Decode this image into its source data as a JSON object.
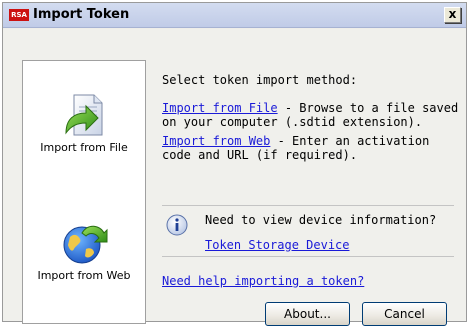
{
  "window": {
    "title": "Import Token",
    "logo_text": "RSA",
    "close_label": "x"
  },
  "left_panel": {
    "items": [
      {
        "label": "Import from File",
        "icon": "document-arrow-icon"
      },
      {
        "label": "Import from Web",
        "icon": "globe-arrow-icon"
      }
    ]
  },
  "main": {
    "heading": "Select token import method:",
    "file_option": {
      "link": "Import from File",
      "desc_line1": " - Browse to a file saved",
      "desc_line2": "on your computer (.sdtid extension)."
    },
    "web_option": {
      "link": "Import from Web",
      "desc_line1": " - Enter an activation",
      "desc_line2": "code and URL (if required)."
    }
  },
  "info": {
    "icon": "info-icon",
    "text": "Need to view device information?",
    "link": "Token Storage Device"
  },
  "help_link": "Need help importing a token?",
  "buttons": {
    "about": "About...",
    "cancel": "Cancel"
  },
  "colors": {
    "link": "#1a1ad8",
    "titlebar": "#c6d0ea",
    "rsa_red": "#cc1111"
  }
}
